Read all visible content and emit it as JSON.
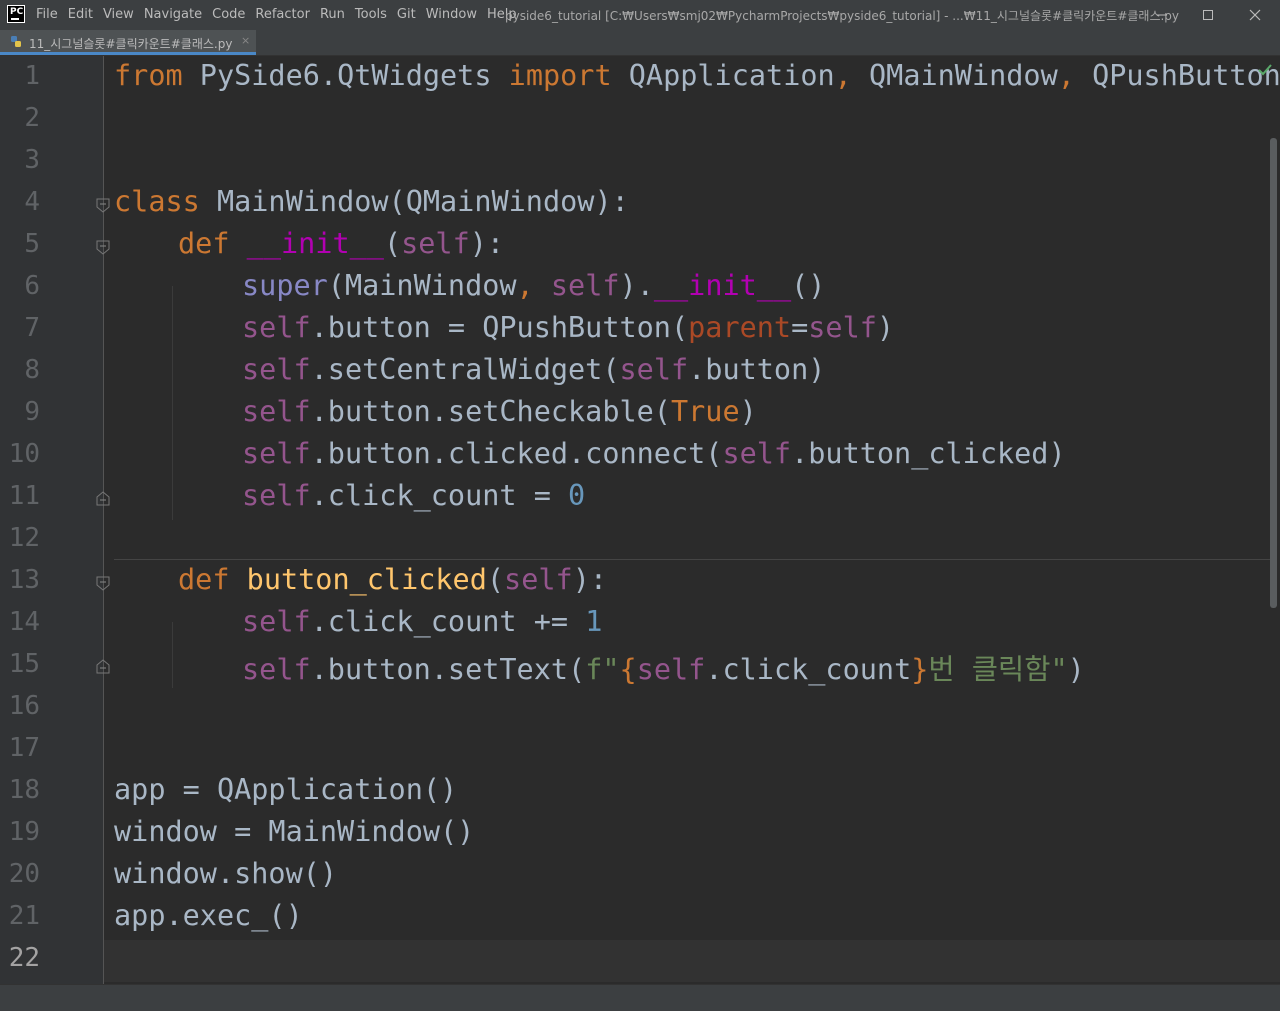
{
  "window": {
    "title": "pyside6_tutorial [C:₩Users₩smj02₩PycharmProjects₩pyside6_tutorial] - ...₩11_시그널슬롯#클릭카운트#클래스.py",
    "app_icon": "PC",
    "menu": [
      "File",
      "Edit",
      "View",
      "Navigate",
      "Code",
      "Refactor",
      "Run",
      "Tools",
      "Git",
      "Window",
      "Help"
    ]
  },
  "tabs": [
    {
      "label": "11_시그널슬롯#클릭카운트#클래스.py",
      "icon": "python-file-icon",
      "close": "×"
    }
  ],
  "editor": {
    "line_numbers": [
      "1",
      "2",
      "3",
      "4",
      "5",
      "6",
      "7",
      "8",
      "9",
      "10",
      "11",
      "12",
      "13",
      "14",
      "15",
      "16",
      "17",
      "18",
      "19",
      "20",
      "21",
      "22"
    ],
    "current_line": 22,
    "inspection_status": "ok-check-icon",
    "code": {
      "l1": [
        "from",
        " PySide6.QtWidgets ",
        "import",
        " QApplication",
        ",",
        " QMainWindow",
        ",",
        " QPushButton"
      ],
      "l4": [
        "class",
        " MainWindow(QMainWindow):"
      ],
      "l5": [
        "def",
        " ",
        "__init__",
        "(",
        "self",
        "):"
      ],
      "l6": [
        "super",
        "(MainWindow",
        ",",
        " ",
        "self",
        ").",
        "__init__",
        "()"
      ],
      "l7": [
        "self",
        ".button = QPushButton(",
        "parent",
        "=",
        "self",
        ")"
      ],
      "l8": [
        "self",
        ".setCentralWidget(",
        "self",
        ".button)"
      ],
      "l9": [
        "self",
        ".button.setCheckable(",
        "True",
        ")"
      ],
      "l10": [
        "self",
        ".button.clicked.connect(",
        "self",
        ".button_clicked)"
      ],
      "l11": [
        "self",
        ".click_count = ",
        "0"
      ],
      "l13": [
        "def",
        " ",
        "button_clicked",
        "(",
        "self",
        "):"
      ],
      "l14": [
        "self",
        ".click_count += ",
        "1"
      ],
      "l15": [
        "self",
        ".button.setText(",
        "f\"",
        "{",
        "self",
        ".click_count",
        "}",
        "번 클릭함\"",
        ")"
      ],
      "l18": "app = QApplication()",
      "l19": "window = MainWindow()",
      "l20": "window.show()",
      "l21": "app.exec_()"
    }
  },
  "colors": {
    "keyword": "#cc7832",
    "self": "#94558d",
    "magic": "#b200b2",
    "builtin": "#8888c6",
    "number": "#6897bb",
    "string": "#6a8759",
    "function_def": "#ffc66d",
    "default_text": "#a9b7c6",
    "background": "#2b2b2b"
  }
}
